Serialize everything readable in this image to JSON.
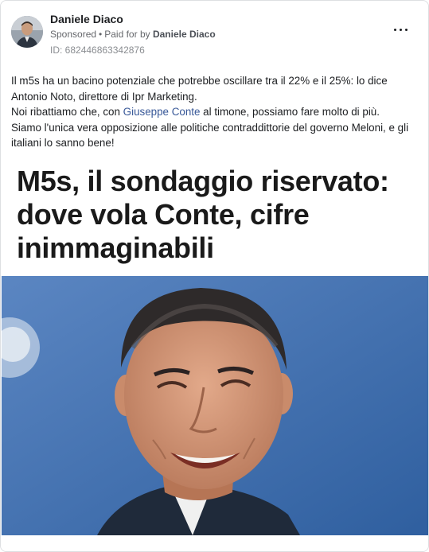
{
  "post": {
    "author_name": "Daniele Diaco",
    "sponsored_label": "Sponsored",
    "separator": "•",
    "paid_for_prefix": "Paid for by",
    "paid_for_name": "Daniele Diaco",
    "ad_id": "ID: 682446863342876",
    "more_icon": "more-options-icon"
  },
  "body": {
    "line1": "Il m5s ha un bacino potenziale che potrebbe oscillare tra il 22% e il 25%: lo dice Antonio Noto, direttore di Ipr Marketing.",
    "line2_before": "Noi ribattiamo che, con ",
    "line2_link": "Giuseppe Conte",
    "line2_after": " al timone, possiamo fare molto di più.",
    "line3": "Siamo l'unica vera opposizione alle politiche contraddittorie del governo Meloni, e gli italiani lo sanno bene!"
  },
  "creative": {
    "headline": "M5s, il sondaggio riservato: dove vola Conte, cifre inimmaginabili"
  },
  "colors": {
    "link": "#385898",
    "photo_bg": "#4a78b8",
    "border": "#dddfe2"
  }
}
